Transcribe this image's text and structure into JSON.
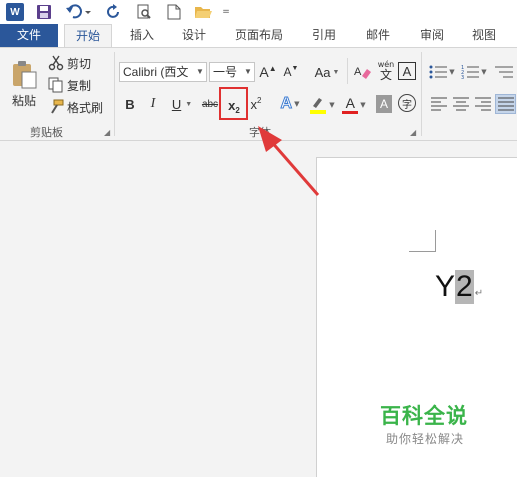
{
  "qat": {
    "app_icon": "W",
    "customize": "="
  },
  "tabs": [
    {
      "label": "文件"
    },
    {
      "label": "开始"
    },
    {
      "label": "插入"
    },
    {
      "label": "设计"
    },
    {
      "label": "页面布局"
    },
    {
      "label": "引用"
    },
    {
      "label": "邮件"
    },
    {
      "label": "审阅"
    },
    {
      "label": "视图"
    }
  ],
  "clipboard": {
    "paste_label": "粘贴",
    "cut_label": "剪切",
    "copy_label": "复制",
    "format_painter_label": "格式刷",
    "group_label": "剪贴板"
  },
  "font": {
    "font_name": "Calibri (西文",
    "font_size": "一号",
    "grow_label": "A",
    "shrink_label": "A",
    "case_label": "Aa",
    "phonetic_top": "wén",
    "phonetic_bottom": "文",
    "border_char": "A",
    "bold": "B",
    "italic": "I",
    "underline": "U",
    "strike": "abc",
    "subscript": "x",
    "subscript_small": "2",
    "superscript": "x",
    "superscript_small": "2",
    "effects": "A",
    "font_color": "A",
    "shading_char": "A",
    "enclose_char": "字",
    "group_label": "字体"
  },
  "document": {
    "text": "Y",
    "highlighted_text": "2",
    "para_mark": "↵"
  },
  "watermark": {
    "title": "百科全说",
    "subtitle": "助你轻松解决"
  },
  "colors": {
    "accent": "#2b579a",
    "highlight_box": "#e03030",
    "watermark_green": "#3ab44a"
  }
}
